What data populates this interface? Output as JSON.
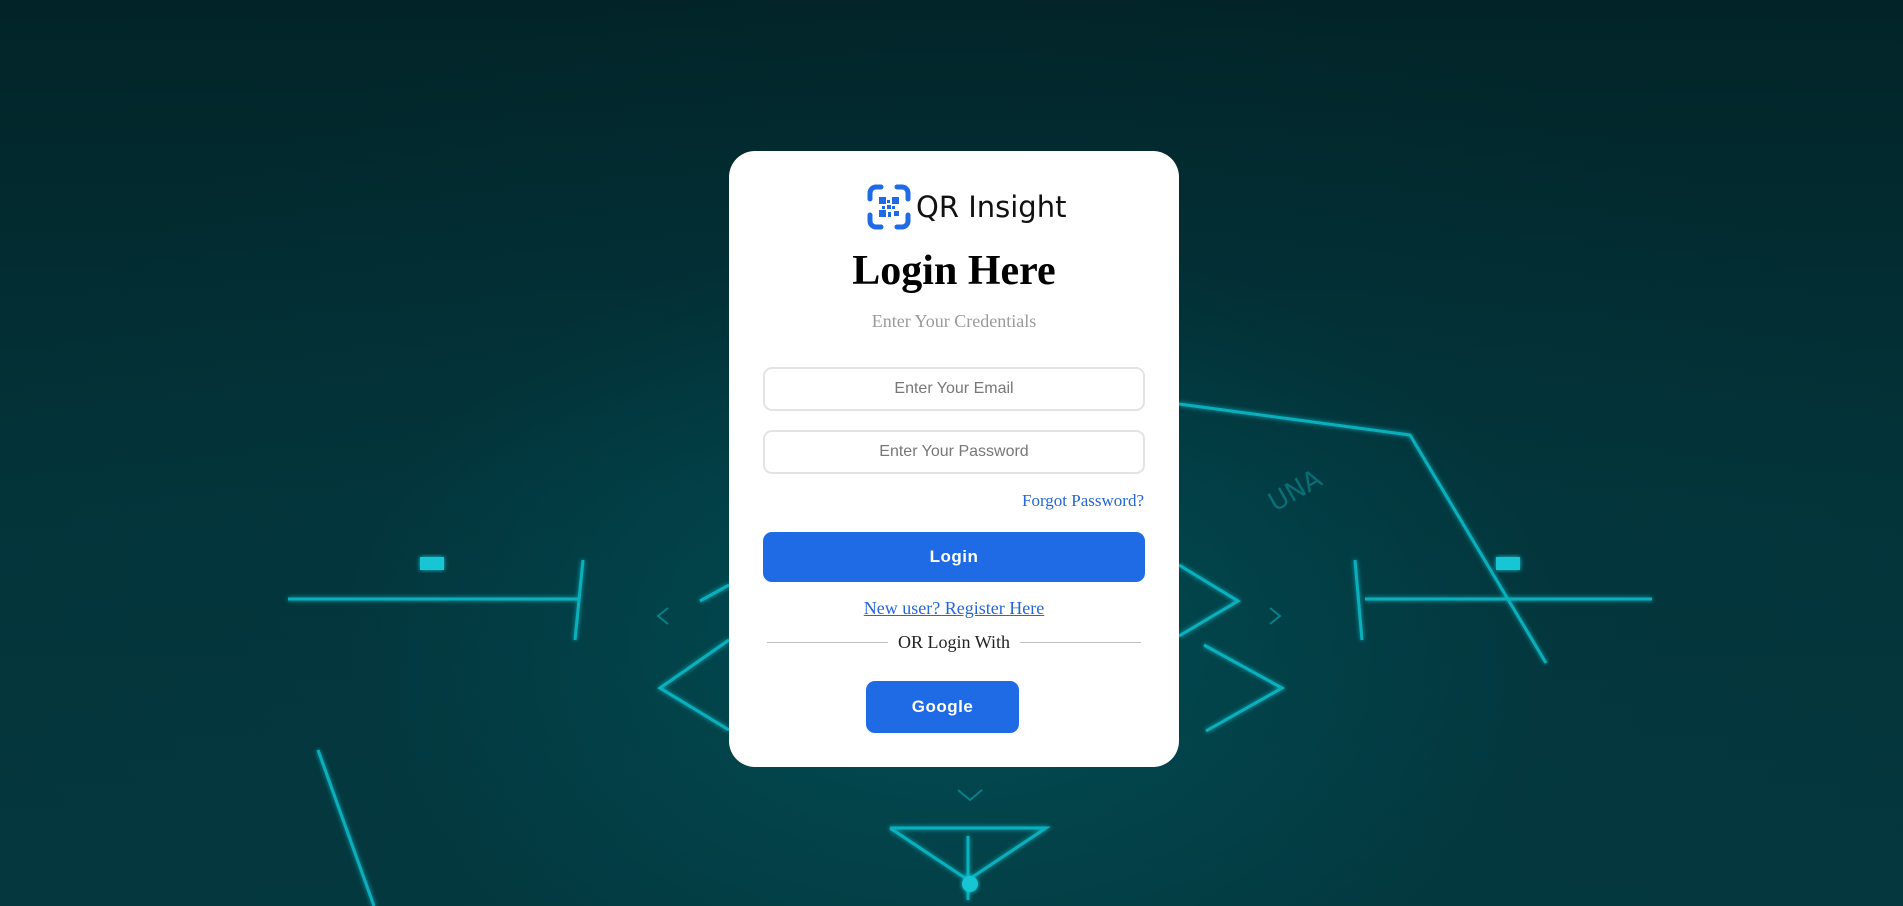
{
  "brand": {
    "name": "QR Insight",
    "accent_color": "#1f6be6",
    "logo_icon": "qr-scan-icon"
  },
  "login": {
    "title": "Login Here",
    "subtitle": "Enter Your Credentials",
    "email_placeholder": "Enter Your Email",
    "email_value": "",
    "password_placeholder": "Enter Your Password",
    "password_value": "",
    "forgot_label": "Forgot Password?",
    "login_label": "Login",
    "register_label": "New user? Register Here",
    "divider_label": "OR Login With",
    "google_label": "Google"
  },
  "colors": {
    "background": "#032a2e",
    "circuit_lines": "#0fbfcf",
    "link": "#2566d8",
    "card": "#ffffff"
  }
}
